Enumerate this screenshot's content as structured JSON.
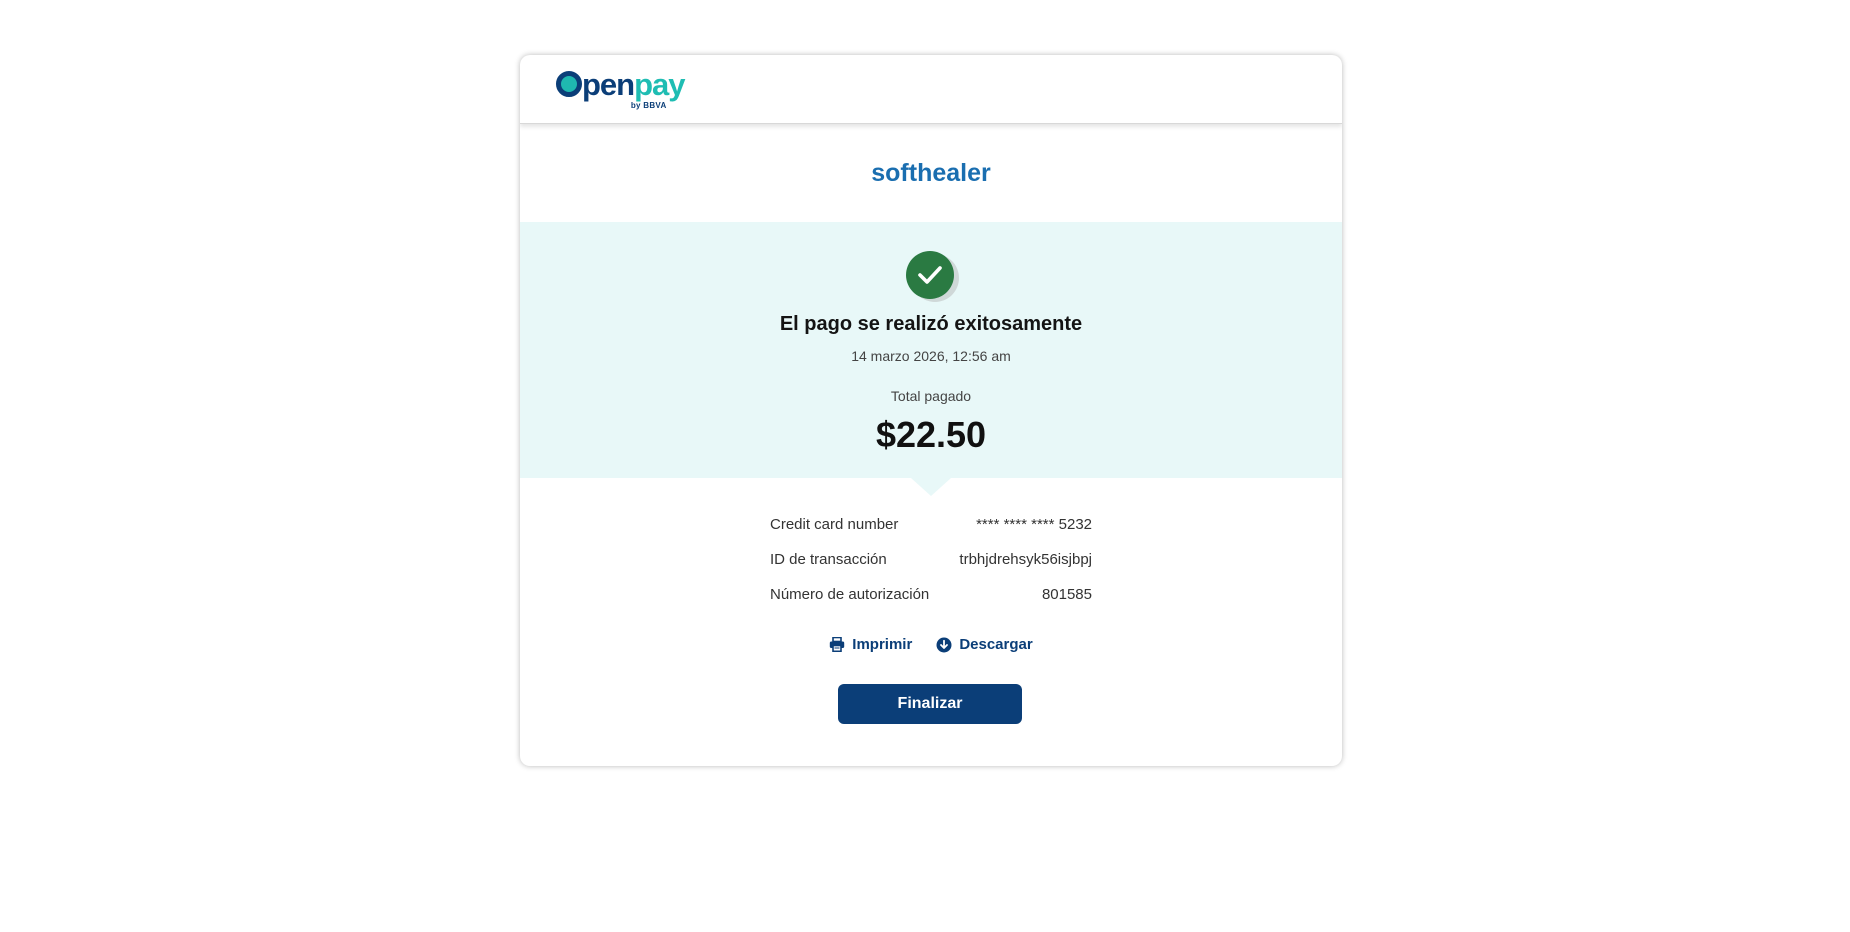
{
  "header": {
    "logo_text_pen": "pen",
    "logo_text_pay": "pay",
    "logo_by": "by BBVA"
  },
  "merchant": {
    "name": "softhealer"
  },
  "result": {
    "status_icon": "check-icon",
    "title": "El pago se realizó exitosamente",
    "date": "14 marzo 2026, 12:56 am",
    "total_label": "Total pagado",
    "total_amount": "$22.50"
  },
  "details": [
    {
      "label": "Credit card number",
      "value": "**** **** **** 5232"
    },
    {
      "label": "ID de transacción",
      "value": "trbhjdrehsyk56isjbpj"
    },
    {
      "label": "Número de autorización",
      "value": "801585"
    }
  ],
  "actions": {
    "print_label": "Imprimir",
    "print_icon": "printer-icon",
    "download_label": "Descargar",
    "download_icon": "download-icon",
    "finish_label": "Finalizar"
  },
  "colors": {
    "brand_navy": "#0b3e78",
    "brand_teal": "#1fbdb3",
    "merchant_blue": "#1a6eb0",
    "success_green": "#2a7a42",
    "panel_bg": "#e8f8f8"
  }
}
